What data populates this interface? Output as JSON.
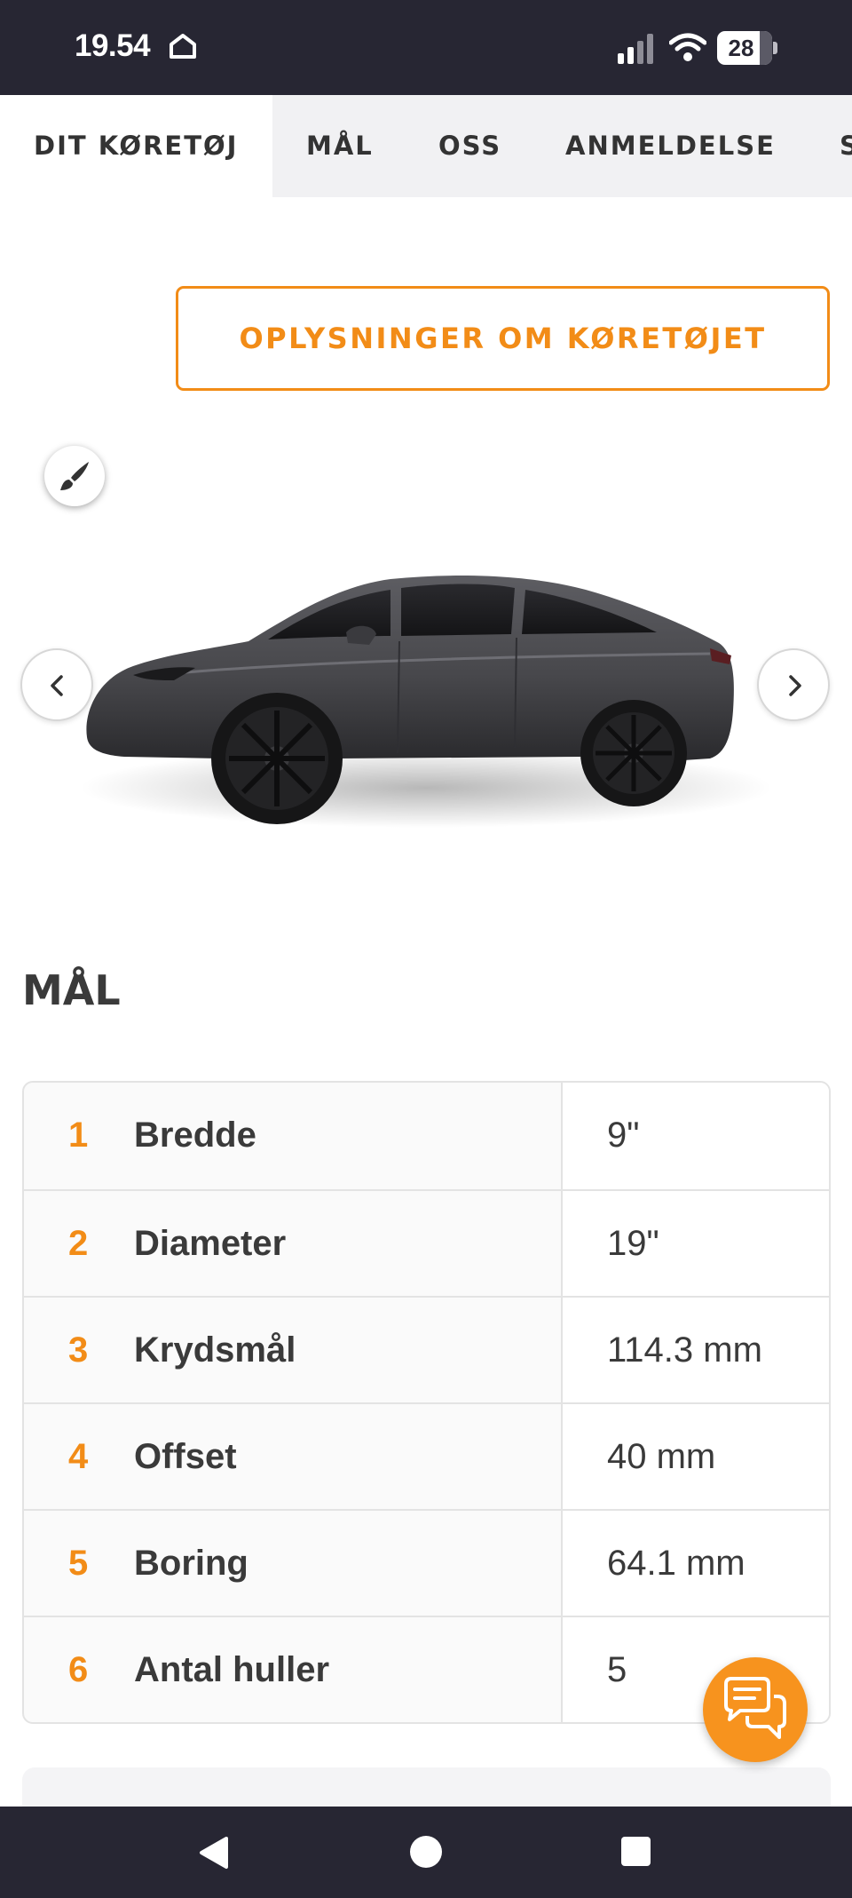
{
  "status_bar": {
    "time": "19.54",
    "battery": "28",
    "icons": [
      "home-outline-icon",
      "cell-signal-icon",
      "wifi-icon",
      "battery-icon"
    ]
  },
  "tabs": [
    {
      "label": "DIT KØRETØJ",
      "active": true
    },
    {
      "label": "MÅL",
      "active": false
    },
    {
      "label": "OSS",
      "active": false
    },
    {
      "label": "ANMELDELSE",
      "active": false
    },
    {
      "label": "S",
      "active": false
    }
  ],
  "vehicle": {
    "details_button_label": "OPLYSNINGER OM KØRETØJET",
    "paint_icon": "paintbrush-icon",
    "prev_icon": "chevron-left-icon",
    "next_icon": "chevron-right-icon",
    "car_color": "#4a4a4e"
  },
  "dimensions": {
    "title": "MÅL",
    "rows": [
      {
        "num": "1",
        "label": "Bredde",
        "value": "9\""
      },
      {
        "num": "2",
        "label": "Diameter",
        "value": "19\""
      },
      {
        "num": "3",
        "label": "Krydsmål",
        "value": "114.3 mm"
      },
      {
        "num": "4",
        "label": "Offset",
        "value": "40 mm"
      },
      {
        "num": "5",
        "label": "Boring",
        "value": "64.1 mm"
      },
      {
        "num": "6",
        "label": "Antal huller",
        "value": "5"
      }
    ]
  },
  "chat": {
    "icon": "chat-bubbles-icon"
  },
  "nav_bar": {
    "icons": [
      "back-triangle-icon",
      "home-circle-icon",
      "recents-square-icon"
    ]
  },
  "colors": {
    "accent": "#f28c17",
    "dark_bar": "#272633",
    "text": "#3a3a3a",
    "tab_background": "#f1f1f3"
  }
}
